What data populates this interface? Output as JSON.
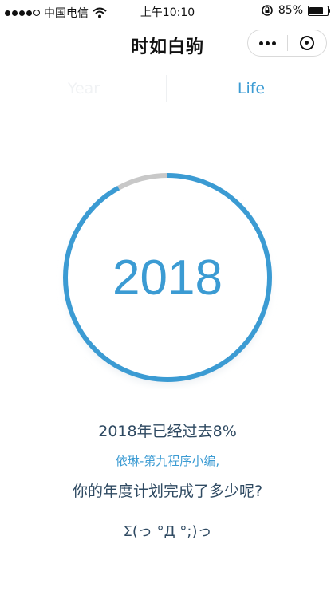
{
  "status_bar": {
    "carrier": "中国电信",
    "time": "上午10:10",
    "battery": "85%",
    "battery_level": 0.85
  },
  "nav": {
    "title": "时如白驹",
    "more_icon": "more-dots-icon",
    "close_icon": "target-icon"
  },
  "tabs": [
    {
      "label": "Year",
      "active": false
    },
    {
      "label": "Life",
      "active": true
    }
  ],
  "progress": {
    "year": "2018",
    "fraction": 0.08,
    "color": "#3b9bd3",
    "remaining_color": "#c8c8c8"
  },
  "text": {
    "elapsed": "2018年已经过去8%",
    "author": "依琳-第九程序小编,",
    "question": "你的年度计划完成了多少呢?",
    "kaomoji": "Σ(っ °Д °;)っ"
  }
}
